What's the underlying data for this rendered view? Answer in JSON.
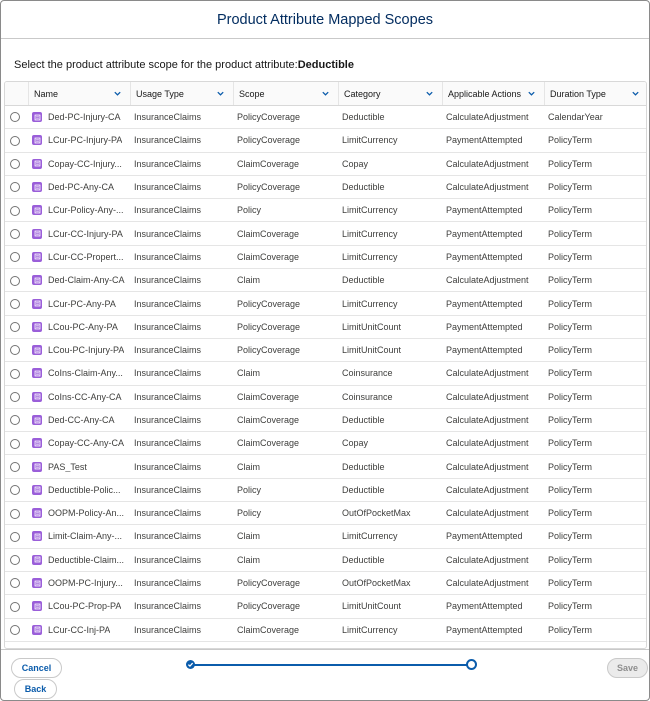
{
  "modal": {
    "title": "Product Attribute Mapped Scopes",
    "instruction_prefix": "Select the product attribute scope for the product attribute:",
    "attribute_name": "Deductible"
  },
  "table": {
    "columns": [
      {
        "label": "Name"
      },
      {
        "label": "Usage Type"
      },
      {
        "label": "Scope"
      },
      {
        "label": "Category"
      },
      {
        "label": "Applicable Actions"
      },
      {
        "label": "Duration Type"
      }
    ],
    "rows": [
      {
        "name": "Ded-PC-Injury-CA",
        "usage": "InsuranceClaims",
        "scope": "PolicyCoverage",
        "category": "Deductible",
        "actions": "CalculateAdjustment",
        "duration": "CalendarYear"
      },
      {
        "name": "LCur-PC-Injury-PA",
        "usage": "InsuranceClaims",
        "scope": "PolicyCoverage",
        "category": "LimitCurrency",
        "actions": "PaymentAttempted",
        "duration": "PolicyTerm"
      },
      {
        "name": "Copay-CC-Injury...",
        "usage": "InsuranceClaims",
        "scope": "ClaimCoverage",
        "category": "Copay",
        "actions": "CalculateAdjustment",
        "duration": "PolicyTerm"
      },
      {
        "name": "Ded-PC-Any-CA",
        "usage": "InsuranceClaims",
        "scope": "PolicyCoverage",
        "category": "Deductible",
        "actions": "CalculateAdjustment",
        "duration": "PolicyTerm"
      },
      {
        "name": "LCur-Policy-Any-...",
        "usage": "InsuranceClaims",
        "scope": "Policy",
        "category": "LimitCurrency",
        "actions": "PaymentAttempted",
        "duration": "PolicyTerm"
      },
      {
        "name": "LCur-CC-Injury-PA",
        "usage": "InsuranceClaims",
        "scope": "ClaimCoverage",
        "category": "LimitCurrency",
        "actions": "PaymentAttempted",
        "duration": "PolicyTerm"
      },
      {
        "name": "LCur-CC-Propert...",
        "usage": "InsuranceClaims",
        "scope": "ClaimCoverage",
        "category": "LimitCurrency",
        "actions": "PaymentAttempted",
        "duration": "PolicyTerm"
      },
      {
        "name": "Ded-Claim-Any-CA",
        "usage": "InsuranceClaims",
        "scope": "Claim",
        "category": "Deductible",
        "actions": "CalculateAdjustment",
        "duration": "PolicyTerm"
      },
      {
        "name": "LCur-PC-Any-PA",
        "usage": "InsuranceClaims",
        "scope": "PolicyCoverage",
        "category": "LimitCurrency",
        "actions": "PaymentAttempted",
        "duration": "PolicyTerm"
      },
      {
        "name": "LCou-PC-Any-PA",
        "usage": "InsuranceClaims",
        "scope": "PolicyCoverage",
        "category": "LimitUnitCount",
        "actions": "PaymentAttempted",
        "duration": "PolicyTerm"
      },
      {
        "name": "LCou-PC-Injury-PA",
        "usage": "InsuranceClaims",
        "scope": "PolicyCoverage",
        "category": "LimitUnitCount",
        "actions": "PaymentAttempted",
        "duration": "PolicyTerm"
      },
      {
        "name": "CoIns-Claim-Any...",
        "usage": "InsuranceClaims",
        "scope": "Claim",
        "category": "Coinsurance",
        "actions": "CalculateAdjustment",
        "duration": "PolicyTerm"
      },
      {
        "name": "CoIns-CC-Any-CA",
        "usage": "InsuranceClaims",
        "scope": "ClaimCoverage",
        "category": "Coinsurance",
        "actions": "CalculateAdjustment",
        "duration": "PolicyTerm"
      },
      {
        "name": "Ded-CC-Any-CA",
        "usage": "InsuranceClaims",
        "scope": "ClaimCoverage",
        "category": "Deductible",
        "actions": "CalculateAdjustment",
        "duration": "PolicyTerm"
      },
      {
        "name": "Copay-CC-Any-CA",
        "usage": "InsuranceClaims",
        "scope": "ClaimCoverage",
        "category": "Copay",
        "actions": "CalculateAdjustment",
        "duration": "PolicyTerm"
      },
      {
        "name": "PAS_Test",
        "usage": "InsuranceClaims",
        "scope": "Claim",
        "category": "Deductible",
        "actions": "CalculateAdjustment",
        "duration": "PolicyTerm"
      },
      {
        "name": "Deductible-Polic...",
        "usage": "InsuranceClaims",
        "scope": "Policy",
        "category": "Deductible",
        "actions": "CalculateAdjustment",
        "duration": "PolicyTerm"
      },
      {
        "name": "OOPM-Policy-An...",
        "usage": "InsuranceClaims",
        "scope": "Policy",
        "category": "OutOfPocketMax",
        "actions": "CalculateAdjustment",
        "duration": "PolicyTerm"
      },
      {
        "name": "Limit-Claim-Any-...",
        "usage": "InsuranceClaims",
        "scope": "Claim",
        "category": "LimitCurrency",
        "actions": "PaymentAttempted",
        "duration": "PolicyTerm"
      },
      {
        "name": "Deductible-Claim...",
        "usage": "InsuranceClaims",
        "scope": "Claim",
        "category": "Deductible",
        "actions": "CalculateAdjustment",
        "duration": "PolicyTerm"
      },
      {
        "name": "OOPM-PC-Injury...",
        "usage": "InsuranceClaims",
        "scope": "PolicyCoverage",
        "category": "OutOfPocketMax",
        "actions": "CalculateAdjustment",
        "duration": "PolicyTerm"
      },
      {
        "name": "LCou-PC-Prop-PA",
        "usage": "InsuranceClaims",
        "scope": "PolicyCoverage",
        "category": "LimitUnitCount",
        "actions": "PaymentAttempted",
        "duration": "PolicyTerm"
      },
      {
        "name": "LCur-CC-Inj-PA",
        "usage": "InsuranceClaims",
        "scope": "ClaimCoverage",
        "category": "LimitCurrency",
        "actions": "PaymentAttempted",
        "duration": "PolicyTerm"
      }
    ]
  },
  "footer": {
    "cancel_label": "Cancel",
    "back_label": "Back",
    "save_label": "Save"
  },
  "progress": {
    "current_step": 2,
    "total_steps": 2
  },
  "colors": {
    "brand_blue": "#0b5cab",
    "title_navy": "#032d60",
    "record_icon_purple": "#9a5ed9"
  },
  "icons": {
    "column_menu": "chevron-down-icon",
    "record": "record-icon",
    "completed_step": "check-icon"
  }
}
